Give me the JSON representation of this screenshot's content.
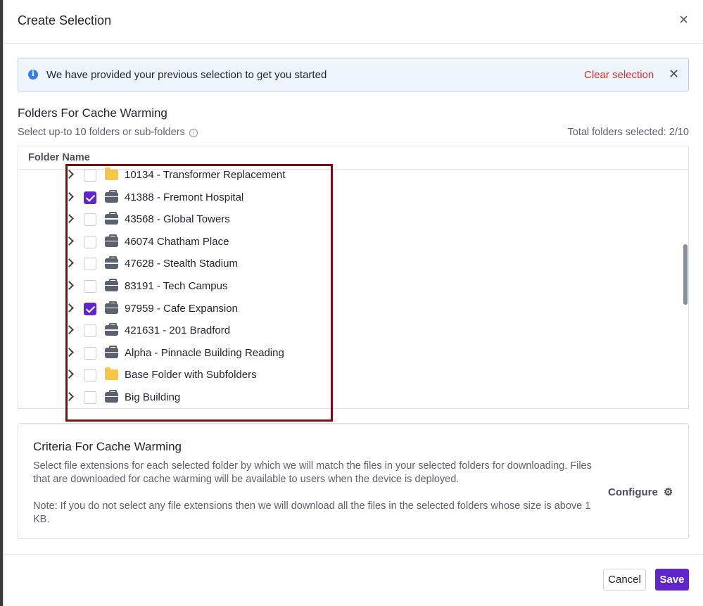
{
  "modal": {
    "title": "Create Selection",
    "close_icon": "close-icon"
  },
  "banner": {
    "icon": "info-icon",
    "message": "We have provided your previous selection to get you started",
    "clear_label": "Clear selection",
    "dismiss_icon": "close-icon"
  },
  "folders": {
    "title": "Folders For Cache Warming",
    "subtitle": "Select up-to 10 folders or sub-folders",
    "subtitle_icon": "info-icon",
    "total_label": "Total folders selected: 2/10",
    "column_header": "Folder Name",
    "items": [
      {
        "label": "10134 - Transformer Replacement",
        "icon": "folder-icon",
        "checked": false
      },
      {
        "label": "41388 - Fremont Hospital",
        "icon": "briefcase-icon",
        "checked": true
      },
      {
        "label": "43568 - Global Towers",
        "icon": "briefcase-icon",
        "checked": false
      },
      {
        "label": "46074 Chatham Place",
        "icon": "briefcase-icon",
        "checked": false
      },
      {
        "label": "47628 - Stealth Stadium",
        "icon": "briefcase-icon",
        "checked": false
      },
      {
        "label": "83191 - Tech Campus",
        "icon": "briefcase-icon",
        "checked": false
      },
      {
        "label": "97959 - Cafe Expansion",
        "icon": "briefcase-icon",
        "checked": true
      },
      {
        "label": "421631 - 201 Bradford",
        "icon": "briefcase-icon",
        "checked": false
      },
      {
        "label": "Alpha - Pinnacle Building Reading",
        "icon": "briefcase-icon",
        "checked": false
      },
      {
        "label": "Base Folder with Subfolders",
        "icon": "folder-icon",
        "checked": false
      },
      {
        "label": "Big Building",
        "icon": "briefcase-icon",
        "checked": false
      }
    ]
  },
  "criteria": {
    "title": "Criteria For Cache Warming",
    "description": "Select file extensions for each selected folder by which we will match the files in your selected folders for downloading. Files that are downloaded for cache warming will be available to users when the device is deployed.",
    "note": "Note: If you do not select any file extensions then we will download all the files in the selected folders whose size is above 1 KB.",
    "configure_label": "Configure",
    "configure_icon": "gear-icon"
  },
  "footer": {
    "cancel_label": "Cancel",
    "save_label": "Save"
  },
  "colors": {
    "accent": "#5f27c9",
    "danger": "#d0312d",
    "info": "#3b7ddd",
    "folder": "#f6c744",
    "highlight": "#7a0c14"
  }
}
